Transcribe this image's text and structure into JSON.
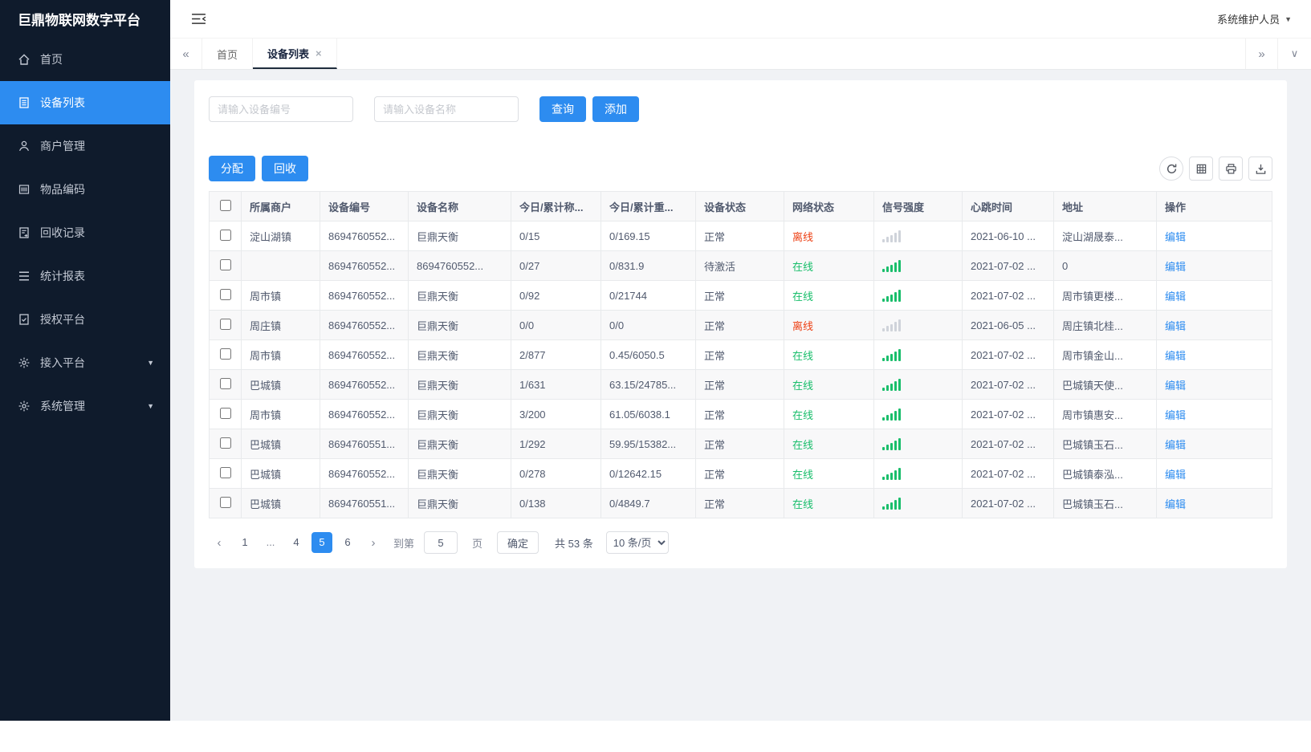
{
  "app": {
    "title": "巨鼎物联网数字平台",
    "user": "系统维护人员"
  },
  "colors": {
    "primary": "#2d8cf0",
    "online": "#19be6b",
    "offline": "#ed4014",
    "sidebar_bg": "#0f1b2c"
  },
  "sidebar": {
    "items": [
      {
        "id": "home",
        "label": "首页",
        "icon": "home-icon",
        "active": false,
        "expandable": false
      },
      {
        "id": "device-list",
        "label": "设备列表",
        "icon": "list-icon",
        "active": true,
        "expandable": false
      },
      {
        "id": "merchant-management",
        "label": "商户管理",
        "icon": "user-icon",
        "active": false,
        "expandable": false
      },
      {
        "id": "item-code",
        "label": "物品编码",
        "icon": "barcode-icon",
        "active": false,
        "expandable": false
      },
      {
        "id": "recycle-records",
        "label": "回收记录",
        "icon": "record-icon",
        "active": false,
        "expandable": false
      },
      {
        "id": "statistics-report",
        "label": "统计报表",
        "icon": "report-icon",
        "active": false,
        "expandable": false
      },
      {
        "id": "authorization-platform",
        "label": "授权平台",
        "icon": "auth-icon",
        "active": false,
        "expandable": false
      },
      {
        "id": "access-platform",
        "label": "接入平台",
        "icon": "gear-icon",
        "active": false,
        "expandable": true
      },
      {
        "id": "system-management",
        "label": "系统管理",
        "icon": "gear-icon",
        "active": false,
        "expandable": true
      }
    ]
  },
  "tabs": [
    {
      "id": "home",
      "label": "首页",
      "active": false,
      "closable": false
    },
    {
      "id": "device-list",
      "label": "设备列表",
      "active": true,
      "closable": true
    }
  ],
  "search": {
    "device_no_placeholder": "请输入设备编号",
    "device_name_placeholder": "请输入设备名称",
    "query_label": "查询",
    "add_label": "添加"
  },
  "toolbar": {
    "allocate_label": "分配",
    "recycle_label": "回收"
  },
  "table": {
    "headers": [
      "所属商户",
      "设备编号",
      "设备名称",
      "今日/累计称...",
      "今日/累计重...",
      "设备状态",
      "网络状态",
      "信号强度",
      "心跳时间",
      "地址",
      "操作"
    ],
    "edit_label": "编辑",
    "rows": [
      {
        "merchant": "淀山湖镇",
        "device_no": "8694760552...",
        "device_name": "巨鼎天衡",
        "today_count": "0/15",
        "today_weight": "0/169.15",
        "device_status": "正常",
        "network_status": "离线",
        "online": false,
        "heartbeat": "2021-06-10 ...",
        "address": "淀山湖晟泰..."
      },
      {
        "merchant": "",
        "device_no": "8694760552...",
        "device_name": "8694760552...",
        "today_count": "0/27",
        "today_weight": "0/831.9",
        "device_status": "待激活",
        "network_status": "在线",
        "online": true,
        "heartbeat": "2021-07-02 ...",
        "address": "0"
      },
      {
        "merchant": "周市镇",
        "device_no": "8694760552...",
        "device_name": "巨鼎天衡",
        "today_count": "0/92",
        "today_weight": "0/21744",
        "device_status": "正常",
        "network_status": "在线",
        "online": true,
        "heartbeat": "2021-07-02 ...",
        "address": "周市镇更楼..."
      },
      {
        "merchant": "周庄镇",
        "device_no": "8694760552...",
        "device_name": "巨鼎天衡",
        "today_count": "0/0",
        "today_weight": "0/0",
        "device_status": "正常",
        "network_status": "离线",
        "online": false,
        "heartbeat": "2021-06-05 ...",
        "address": "周庄镇北桂..."
      },
      {
        "merchant": "周市镇",
        "device_no": "8694760552...",
        "device_name": "巨鼎天衡",
        "today_count": "2/877",
        "today_weight": "0.45/6050.5",
        "device_status": "正常",
        "network_status": "在线",
        "online": true,
        "heartbeat": "2021-07-02 ...",
        "address": "周市镇金山..."
      },
      {
        "merchant": "巴城镇",
        "device_no": "8694760552...",
        "device_name": "巨鼎天衡",
        "today_count": "1/631",
        "today_weight": "63.15/24785...",
        "device_status": "正常",
        "network_status": "在线",
        "online": true,
        "heartbeat": "2021-07-02 ...",
        "address": "巴城镇天使..."
      },
      {
        "merchant": "周市镇",
        "device_no": "8694760552...",
        "device_name": "巨鼎天衡",
        "today_count": "3/200",
        "today_weight": "61.05/6038.1",
        "device_status": "正常",
        "network_status": "在线",
        "online": true,
        "heartbeat": "2021-07-02 ...",
        "address": "周市镇惠安..."
      },
      {
        "merchant": "巴城镇",
        "device_no": "8694760551...",
        "device_name": "巨鼎天衡",
        "today_count": "1/292",
        "today_weight": "59.95/15382...",
        "device_status": "正常",
        "network_status": "在线",
        "online": true,
        "heartbeat": "2021-07-02 ...",
        "address": "巴城镇玉石..."
      },
      {
        "merchant": "巴城镇",
        "device_no": "8694760552...",
        "device_name": "巨鼎天衡",
        "today_count": "0/278",
        "today_weight": "0/12642.15",
        "device_status": "正常",
        "network_status": "在线",
        "online": true,
        "heartbeat": "2021-07-02 ...",
        "address": "巴城镇泰泓..."
      },
      {
        "merchant": "巴城镇",
        "device_no": "8694760551...",
        "device_name": "巨鼎天衡",
        "today_count": "0/138",
        "today_weight": "0/4849.7",
        "device_status": "正常",
        "network_status": "在线",
        "online": true,
        "heartbeat": "2021-07-02 ...",
        "address": "巴城镇玉石..."
      }
    ]
  },
  "pagination": {
    "pages": [
      {
        "label": "1",
        "active": false,
        "ellipsis": false
      },
      {
        "label": "...",
        "active": false,
        "ellipsis": true
      },
      {
        "label": "4",
        "active": false,
        "ellipsis": false
      },
      {
        "label": "5",
        "active": true,
        "ellipsis": false
      },
      {
        "label": "6",
        "active": false,
        "ellipsis": false
      }
    ],
    "goto_label": "到第",
    "goto_value": "5",
    "page_unit": "页",
    "confirm_label": "确定",
    "total_label": "共 53 条",
    "page_size": "10 条/页",
    "page_size_options": [
      "10 条/页"
    ]
  }
}
